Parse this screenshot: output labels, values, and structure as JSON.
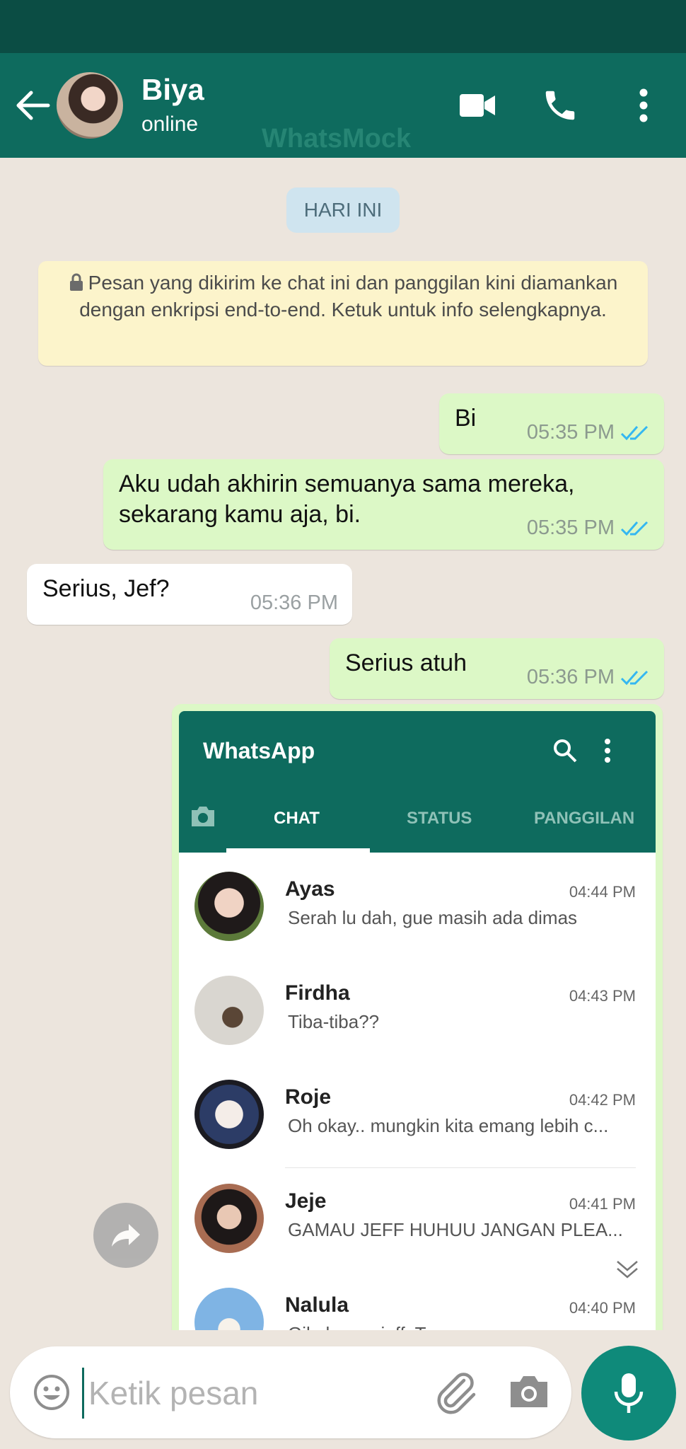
{
  "header": {
    "contact_name": "Biya",
    "status": "online",
    "watermark": "WhatsMock",
    "icons": [
      "back-arrow-icon",
      "video-call-icon",
      "phone-icon",
      "more-vert-icon"
    ]
  },
  "chat": {
    "date_label": "HARI INI",
    "encryption_notice": "Pesan yang dikirim ke chat ini dan panggilan kini diamankan dengan enkripsi end-to-end. Ketuk untuk info selengkapnya.",
    "messages": [
      {
        "direction": "out",
        "text": "Bi",
        "time": "05:35 PM",
        "status": "read"
      },
      {
        "direction": "out",
        "text": "Aku udah akhirin semuanya sama mereka, sekarang kamu aja, bi.",
        "time": "05:35 PM",
        "status": "read"
      },
      {
        "direction": "in",
        "text": "Serius, Jef?",
        "time": "05:36 PM"
      },
      {
        "direction": "out",
        "text": "Serius atuh",
        "time": "05:36 PM",
        "status": "read"
      }
    ],
    "image_message": {
      "app_title": "WhatsApp",
      "tabs": [
        "CHAT",
        "STATUS",
        "PANGGILAN"
      ],
      "active_tab": "CHAT",
      "chats": [
        {
          "name": "Ayas",
          "time": "04:44 PM",
          "preview": "Serah lu dah, gue masih ada dimas"
        },
        {
          "name": "Firdha",
          "time": "04:43 PM",
          "preview": "Tiba-tiba??"
        },
        {
          "name": "Roje",
          "time": "04:42 PM",
          "preview": "Oh okay.. mungkin kita emang lebih c..."
        },
        {
          "name": "Jeje",
          "time": "04:41 PM",
          "preview": "GAMAU JEFF HUHUU JANGAN PLEA..."
        },
        {
          "name": "Nalula",
          "time": "04:40 PM",
          "preview": "Gila kamu, jeff. Tega"
        }
      ]
    }
  },
  "composer": {
    "placeholder": "Ketik pesan",
    "icons": [
      "emoji-icon",
      "attach-icon",
      "camera-icon",
      "mic-icon"
    ]
  },
  "colors": {
    "header": "#0e6b5e",
    "statusbar": "#0b4d44",
    "outgoing_bubble": "#dcf8c6",
    "read_ticks": "#34b7f1"
  }
}
